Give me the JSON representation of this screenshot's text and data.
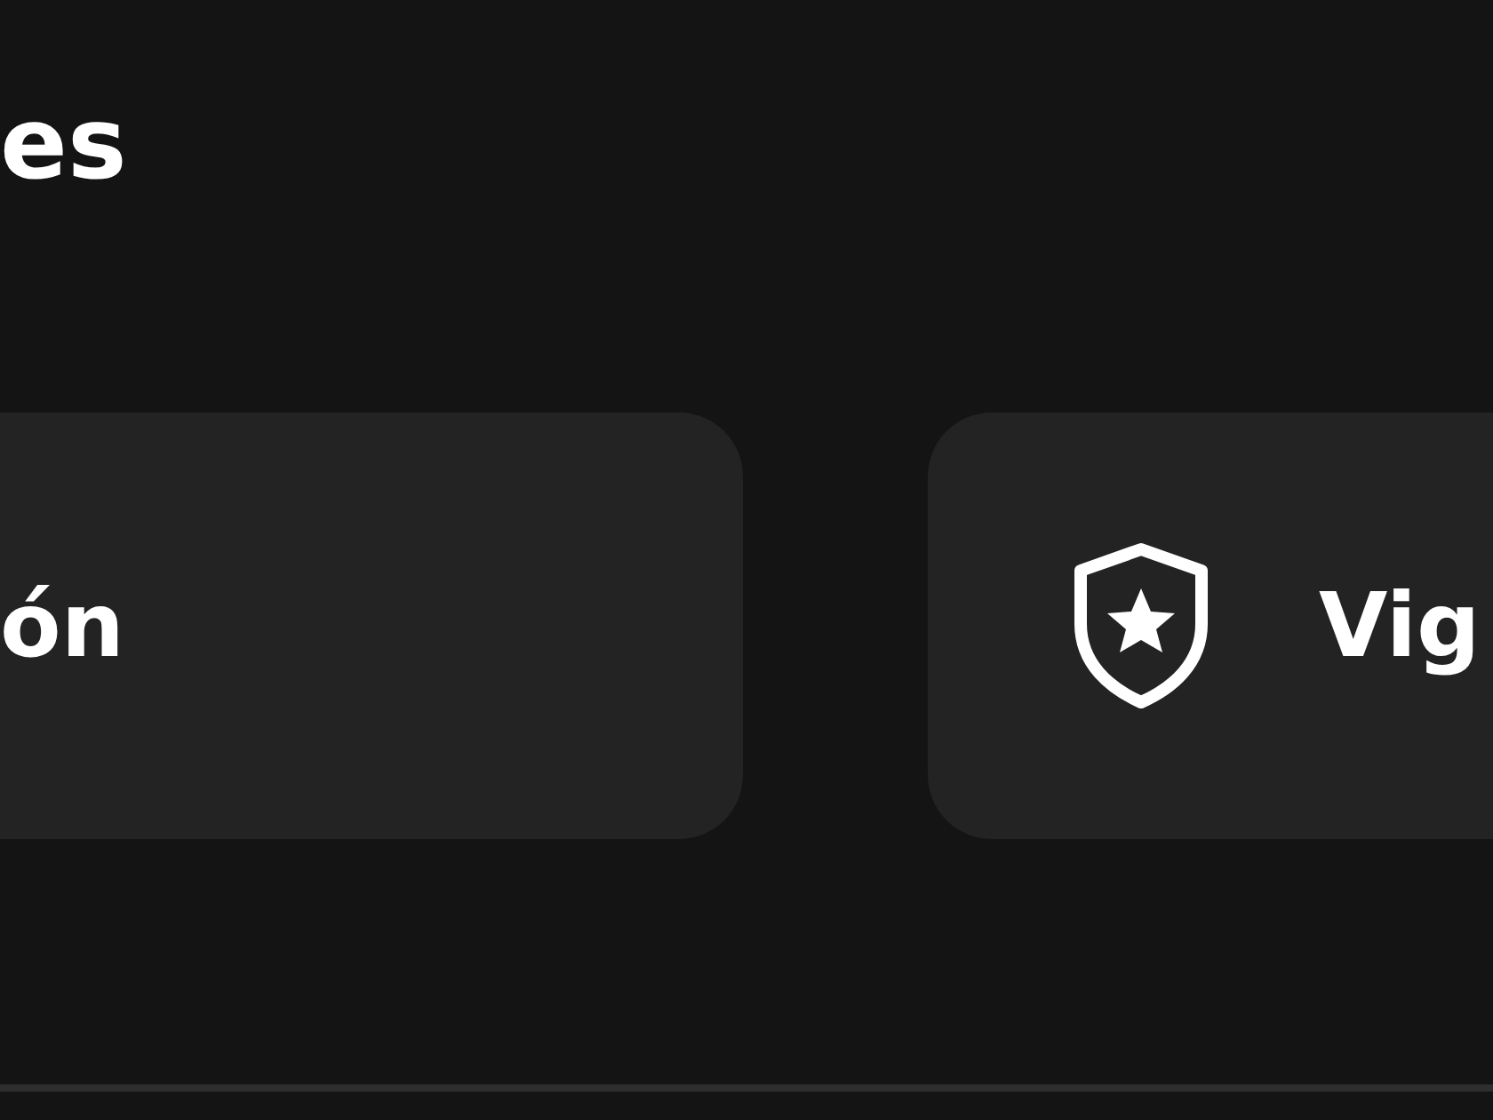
{
  "heading": "es",
  "cards": [
    {
      "kind": "plain",
      "label": "ón"
    },
    {
      "kind": "shield",
      "label": "Vig"
    }
  ]
}
